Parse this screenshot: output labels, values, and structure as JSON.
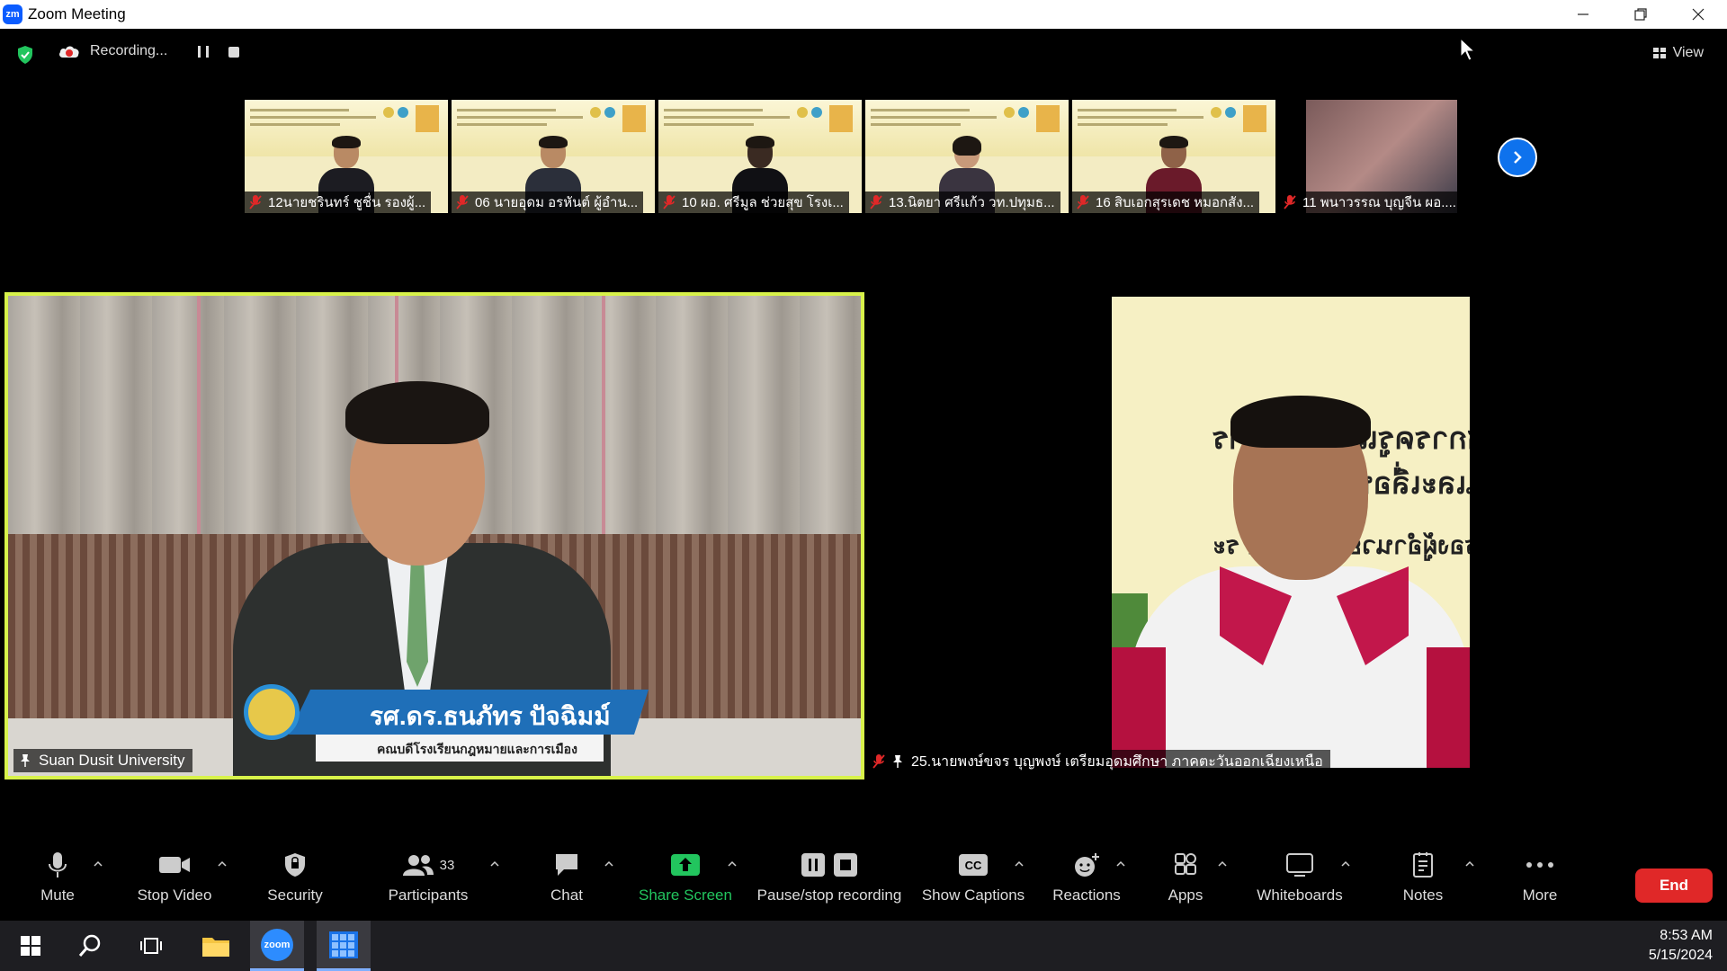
{
  "window": {
    "title": "Zoom Meeting",
    "logo_text": "zm"
  },
  "topbar": {
    "recording_label": "Recording...",
    "view_label": "View"
  },
  "thumbnails": [
    {
      "name": "12นายชรินทร์ ชูชื่น รองผู้..."
    },
    {
      "name": "06 นายอุดม อรหันต์ ผู้อำน..."
    },
    {
      "name": "10 ผอ. ศรีมูล ช่วยสุข โรงเ..."
    },
    {
      "name": "13.นิตยา ศรีแก้ว วท.ปทุมธ..."
    },
    {
      "name": "16 สิบเอกสุรเดช หมอกสัง..."
    },
    {
      "name": "11 พนาวรรณ บุญจีน ผอ...."
    }
  ],
  "main_video": {
    "participant_label": "Suan Dusit University",
    "lower_third_name": "รศ.ดร.ธนภัทร ปัจฉิมม์",
    "lower_third_sub": "คณบดีโรงเรียนกฎหมายและการเมือง"
  },
  "right_video": {
    "participant_label": "25.นายพงษ์ขจร บุญพงษ์ เตรียมอุดมศึกษา ภาคตะวันออกเฉียงเหนือ",
    "bg_lines": [
      "ชการครูและบุคลากร",
      "นและเลื่อนเป็นวิ",
      "รองผู้อำนวยการพิเศษ ระ"
    ]
  },
  "toolbar": {
    "mute": "Mute",
    "stop_video": "Stop Video",
    "security": "Security",
    "participants": "Participants",
    "participants_count": "33",
    "chat": "Chat",
    "share_screen": "Share Screen",
    "pause_recording": "Pause/stop recording",
    "show_captions": "Show Captions",
    "cc_text": "CC",
    "reactions": "Reactions",
    "apps": "Apps",
    "whiteboards": "Whiteboards",
    "notes": "Notes",
    "more": "More",
    "end": "End"
  },
  "taskbar": {
    "zoom_label": "zoom",
    "time": "8:53 AM",
    "date": "5/15/2024"
  },
  "colors": {
    "active_speaker_border": "#d8f24a",
    "end_button": "#e02828",
    "share_green": "#22c55e",
    "zoom_blue": "#0b5cff"
  }
}
